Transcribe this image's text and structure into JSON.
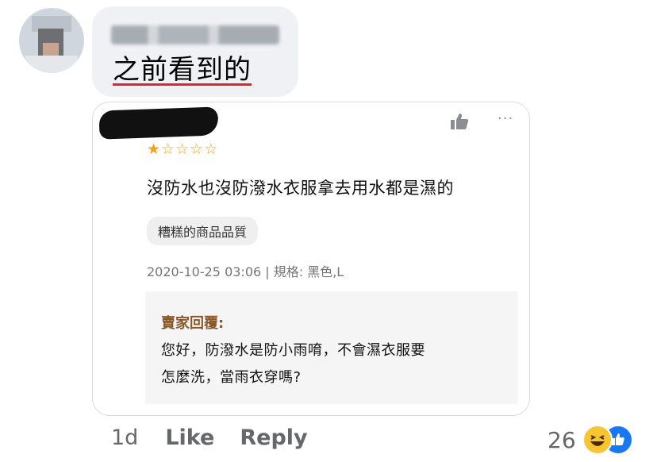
{
  "comment": {
    "text": "之前看到的",
    "icons": {
      "avatar": "blurred-avatar",
      "author_name": "blurred-author-name"
    }
  },
  "review": {
    "stars": [
      "★",
      "☆",
      "☆",
      "☆",
      "☆"
    ],
    "rating": 1,
    "max_rating": 5,
    "text": "沒防水也沒防潑水衣服拿去用水都是濕的",
    "tag": "糟糕的商品品質",
    "meta": "2020-10-25 03:06 | 規格: 黑色,L",
    "more": "···",
    "icons": {
      "like": "thumbs-up-icon",
      "more": "more-icon",
      "redaction": "redacted-username"
    },
    "seller_reply": {
      "title": "賣家回覆:",
      "line1": "您好，防潑水是防小雨唷，不會濕衣服要",
      "line2": "怎麼洗，當雨衣穿嗎?"
    }
  },
  "actions": {
    "time": "1d",
    "like": "Like",
    "reply": "Reply"
  },
  "reactions": {
    "count": "26",
    "icons": [
      "haha-icon",
      "like-icon"
    ]
  },
  "colors": {
    "bubble": "#eff1f4",
    "underline": "#e0242c",
    "star": "#f0a225",
    "seller_title": "#8a5a2b",
    "fb_blue": "#1877f2",
    "haha_yellow": "#f7c531"
  }
}
